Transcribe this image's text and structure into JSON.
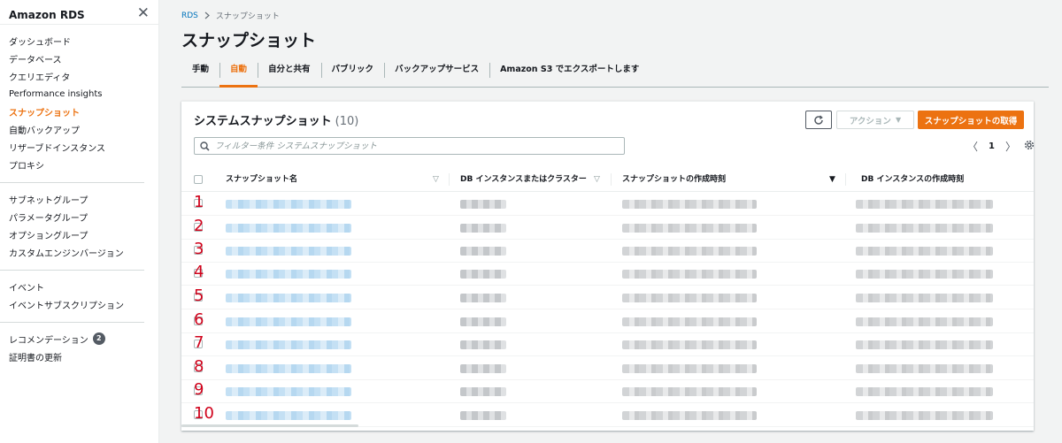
{
  "sidebar": {
    "title": "Amazon RDS",
    "groups": [
      [
        {
          "label": "ダッシュボード"
        },
        {
          "label": "データベース"
        },
        {
          "label": "クエリエディタ"
        },
        {
          "label": "Performance insights"
        },
        {
          "label": "スナップショット",
          "active": true
        },
        {
          "label": "自動バックアップ"
        },
        {
          "label": "リザーブドインスタンス"
        },
        {
          "label": "プロキシ"
        }
      ],
      [
        {
          "label": "サブネットグループ"
        },
        {
          "label": "パラメータグループ"
        },
        {
          "label": "オプショングループ"
        },
        {
          "label": "カスタムエンジンバージョン"
        }
      ],
      [
        {
          "label": "イベント"
        },
        {
          "label": "イベントサブスクリプション"
        }
      ],
      [
        {
          "label": "レコメンデーション",
          "badge": "2"
        },
        {
          "label": "証明書の更新"
        }
      ]
    ]
  },
  "breadcrumb": {
    "root": "RDS",
    "current": "スナップショット"
  },
  "page_title": "スナップショット",
  "tabs": [
    {
      "label": "手動"
    },
    {
      "label": "自動",
      "active": true
    },
    {
      "label": "自分と共有"
    },
    {
      "label": "パブリック"
    },
    {
      "label": "バックアップサービス"
    },
    {
      "label": "Amazon S3 でエクスポートします"
    }
  ],
  "panel": {
    "title": "システムスナップショット",
    "count": "(10)",
    "action_label": "アクション",
    "create_label": "スナップショットの取得",
    "filter_placeholder": "フィルター条件 システムスナップショット",
    "page": "1"
  },
  "columns": {
    "name": "スナップショット名",
    "db": "DB インスタンスまたはクラスター",
    "created": "スナップショットの作成時刻",
    "db_created": "DB インスタンスの作成時刻"
  },
  "rows": [
    "1",
    "2",
    "3",
    "4",
    "5",
    "6",
    "7",
    "8",
    "9",
    "10"
  ],
  "colors": {
    "accent": "#ec7211",
    "link": "#0073bb",
    "annotation": "#d0021b"
  }
}
